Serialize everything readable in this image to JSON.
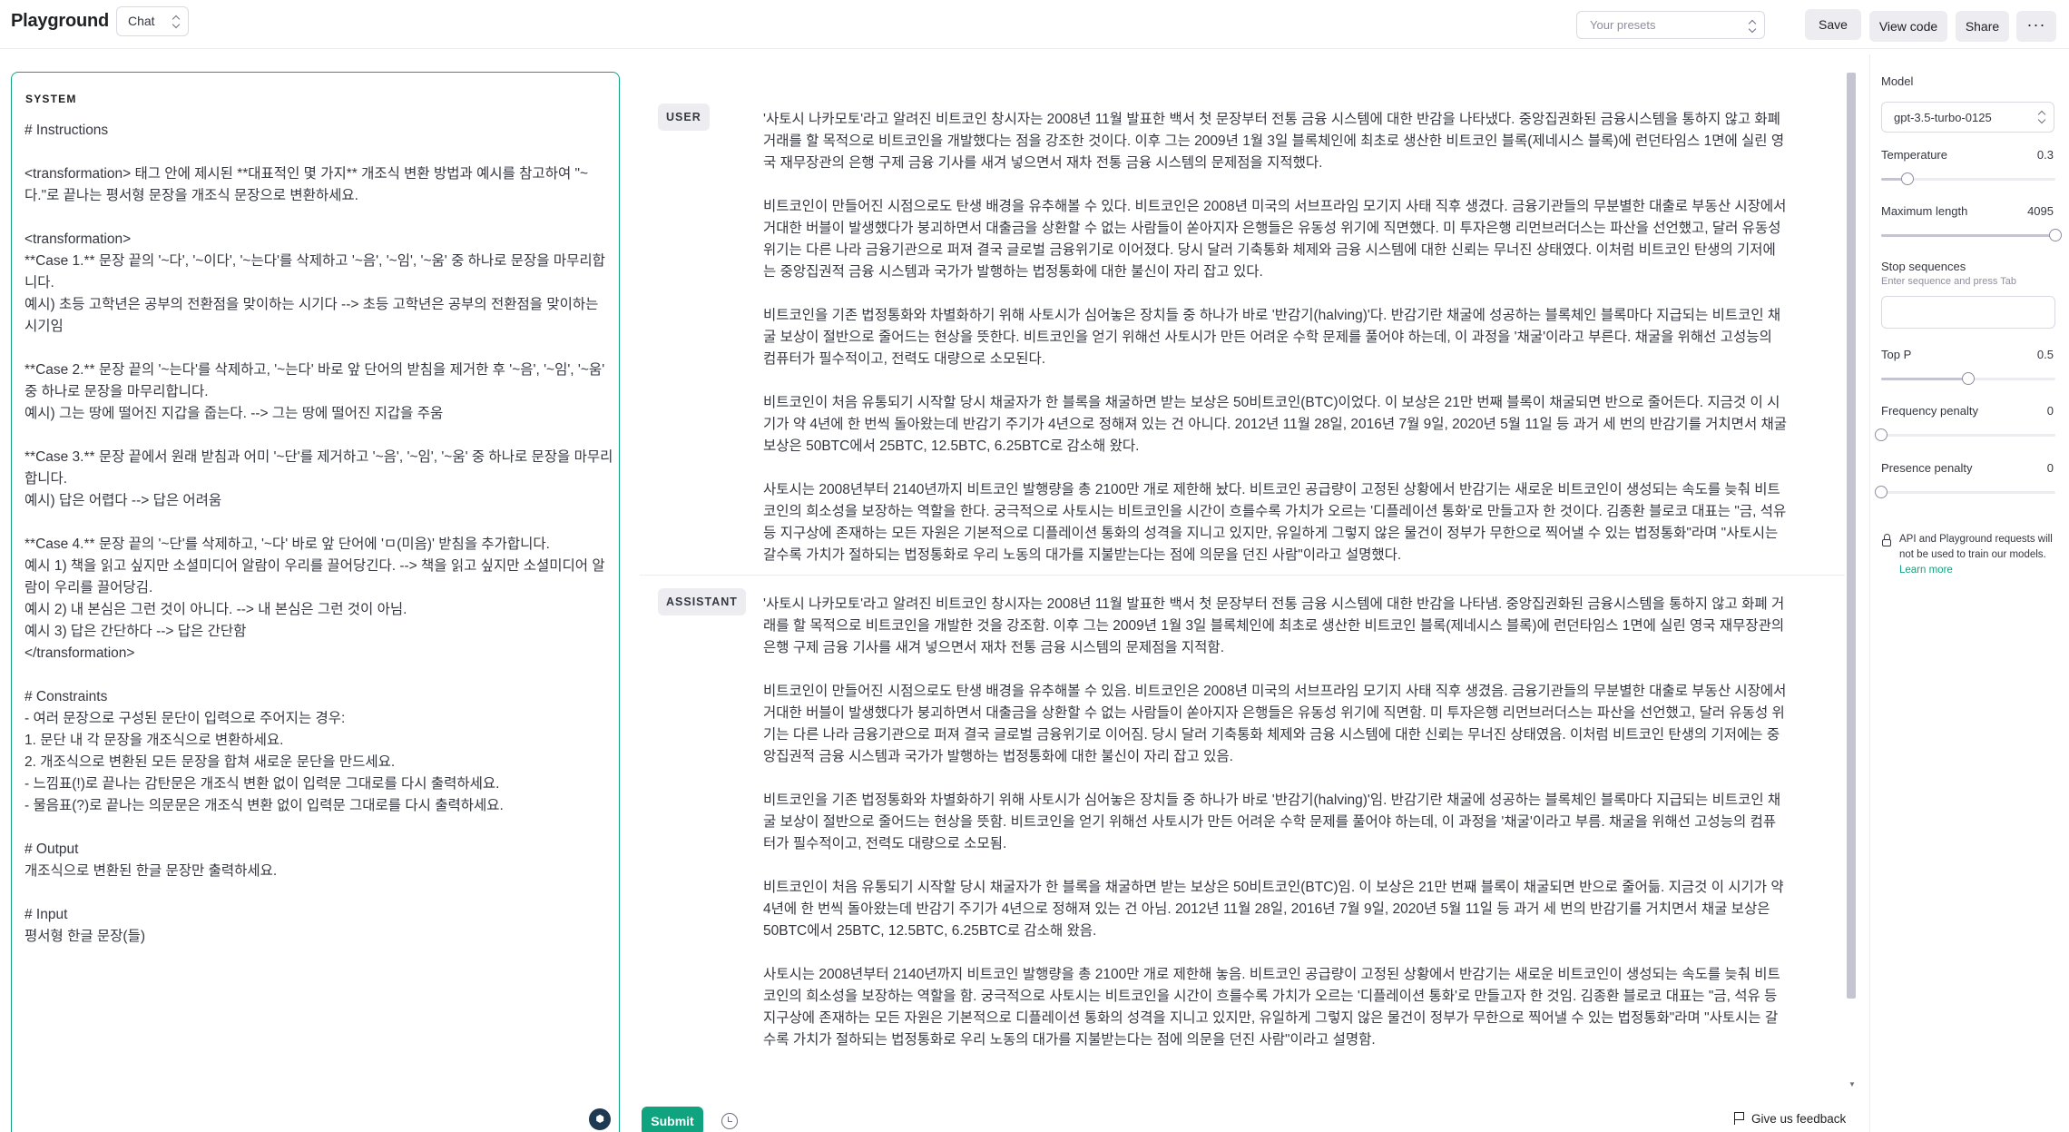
{
  "header": {
    "title": "Playground",
    "mode": "Chat",
    "presets_placeholder": "Your presets",
    "save": "Save",
    "view_code": "View code",
    "share": "Share",
    "more": "···"
  },
  "system": {
    "label": "SYSTEM",
    "text": "# Instructions\n\n<transformation> 태그 안에 제시된 **대표적인 몇 가지** 개조식 변환 방법과 예시를 참고하여 \"~다.\"로 끝나는 평서형 문장을 개조식 문장으로 변환하세요.\n\n<transformation>\n**Case 1.** 문장 끝의 '~다', '~이다', '~는다'를 삭제하고 '~음', '~임', '~움' 중 하나로 문장을 마무리합니다.\n예시) 초등 고학년은 공부의 전환점을 맞이하는 시기다 --> 초등 고학년은 공부의 전환점을 맞이하는 시기임\n\n**Case 2.** 문장 끝의 '~는다'를 삭제하고, '~는다' 바로 앞 단어의 받침을 제거한 후 '~음', '~임', '~움' 중 하나로 문장을 마무리합니다.\n예시) 그는 땅에 떨어진 지갑을 줍는다. --> 그는 땅에 떨어진 지갑을 주움\n\n**Case 3.** 문장 끝에서 원래 받침과 어미 '~단'를 제거하고 '~음', '~임', '~움' 중 하나로 문장을 마무리합니다.\n예시) 답은 어렵다 --> 답은 어려움\n\n**Case 4.** 문장 끝의 '~단'를 삭제하고, '~다' 바로 앞 단어에 'ㅁ(미음)' 받침을 추가합니다.\n예시 1) 책을 읽고 싶지만 소셜미디어 알람이 우리를 끌어당긴다. --> 책을 읽고 싶지만 소셜미디어 알람이 우리를 끌어당김.\n예시 2) 내 본심은 그런 것이 아니다. --> 내 본심은 그런 것이 아님.\n예시 3) 답은 간단하다 --> 답은 간단함\n</transformation>\n\n# Constraints\n- 여러 문장으로 구성된 문단이 입력으로 주어지는 경우:\n1. 문단 내 각 문장을 개조식으로 변환하세요.\n2. 개조식으로 변환된 모든 문장을 합쳐 새로운 문단을 만드세요.\n- 느낌표(!)로 끝나는 감탄문은 개조식 변환 없이 입력문 그대로를 다시 출력하세요.\n- 물음표(?)로 끝나는 의문문은 개조식 변환 없이 입력문 그대로를 다시 출력하세요.\n\n# Output\n개조식으로 변환된 한글 문장만 출력하세요.\n\n# Input\n평서형 한글 문장(들)"
  },
  "messages": [
    {
      "role": "USER",
      "paragraphs": [
        "'사토시 나카모토'라고 알려진 비트코인 창시자는 2008년 11월 발표한 백서 첫 문장부터 전통 금융 시스템에 대한 반감을 나타냈다. 중앙집권화된 금융시스템을 통하지 않고 화폐 거래를 할 목적으로 비트코인을 개발했다는 점을 강조한 것이다. 이후 그는 2009년 1월 3일 블록체인에 최초로 생산한 비트코인 블록(제네시스 블록)에 런던타임스 1면에 실린 영국 재무장관의 은행 구제 금융 기사를 새겨 넣으면서 재차 전통 금융 시스템의 문제점을 지적했다.",
        "비트코인이 만들어진 시점으로도 탄생 배경을 유추해볼 수 있다. 비트코인은 2008년 미국의 서브프라임 모기지 사태 직후 생겼다. 금융기관들의 무분별한 대출로 부동산 시장에서 거대한 버블이 발생했다가 붕괴하면서 대출금을 상환할 수 없는 사람들이 쏟아지자 은행들은 유동성 위기에 직면했다. 미 투자은행 리먼브러더스는 파산을 선언했고, 달러 유동성 위기는 다른 나라 금융기관으로 퍼져 결국 글로벌 금융위기로 이어졌다. 당시 달러 기축통화 체제와 금융 시스템에 대한 신뢰는 무너진 상태였다. 이처럼 비트코인 탄생의 기저에는 중앙집권적 금융 시스템과 국가가 발행하는 법정통화에 대한 불신이 자리 잡고 있다.",
        "비트코인을 기존 법정통화와 차별화하기 위해 사토시가 심어놓은 장치들 중 하나가 바로 '반감기(halving)'다. 반감기란 채굴에 성공하는 블록체인 블록마다 지급되는 비트코인 채굴 보상이 절반으로 줄어드는 현상을 뜻한다. 비트코인을 얻기 위해선 사토시가 만든 어려운 수학 문제를 풀어야 하는데, 이 과정을 '채굴'이라고 부른다. 채굴을 위해선 고성능의 컴퓨터가 필수적이고, 전력도 대량으로 소모된다.",
        "비트코인이 처음 유통되기 시작할 당시 채굴자가 한 블록을 채굴하면 받는 보상은 50비트코인(BTC)이었다. 이 보상은 21만 번째 블록이 채굴되면 반으로 줄어든다. 지금것 이 시기가 약 4년에 한 번씩 돌아왔는데 반감기 주기가 4년으로 정해져 있는 건 아니다. 2012년 11월 28일, 2016년 7월 9일, 2020년 5월 11일 등 과거 세 번의 반감기를 거치면서 채굴 보상은 50BTC에서 25BTC, 12.5BTC, 6.25BTC로 감소해 왔다.",
        "사토시는 2008년부터 2140년까지 비트코인 발행량을 총 2100만 개로 제한해 놨다. 비트코인 공급량이 고정된 상황에서 반감기는 새로운 비트코인이 생성되는 속도를 늦춰 비트코인의 희소성을 보장하는 역할을 한다. 궁극적으로 사토시는 비트코인을 시간이 흐를수록 가치가 오르는 '디플레이션 통화'로 만들고자 한 것이다. 김종환 블로코 대표는 \"금, 석유 등 지구상에 존재하는 모든 자원은 기본적으로 디플레이션 통화의 성격을 지니고 있지만, 유일하게 그렇지 않은 물건이 정부가 무한으로 찍어낼 수 있는 법정통화\"라며 \"사토시는 갈수록 가치가 절하되는 법정통화로 우리 노동의 대가를 지불받는다는 점에 의문을 던진 사람\"이라고 설명했다."
      ]
    },
    {
      "role": "ASSISTANT",
      "paragraphs": [
        "'사토시 나카모토'라고 알려진 비트코인 창시자는 2008년 11월 발표한 백서 첫 문장부터 전통 금융 시스템에 대한 반감을 나타냄. 중앙집권화된 금융시스템을 통하지 않고 화폐 거래를 할 목적으로 비트코인을 개발한 것을 강조함. 이후 그는 2009년 1월 3일 블록체인에 최초로 생산한 비트코인 블록(제네시스 블록)에 런던타임스 1면에 실린 영국 재무장관의 은행 구제 금융 기사를 새겨 넣으면서 재차 전통 금융 시스템의 문제점을 지적함.",
        "비트코인이 만들어진 시점으로도 탄생 배경을 유추해볼 수 있음. 비트코인은 2008년 미국의 서브프라임 모기지 사태 직후 생겼음. 금융기관들의 무분별한 대출로 부동산 시장에서 거대한 버블이 발생했다가 붕괴하면서 대출금을 상환할 수 없는 사람들이 쏟아지자 은행들은 유동성 위기에 직면함. 미 투자은행 리먼브러더스는 파산을 선언했고, 달러 유동성 위기는 다른 나라 금융기관으로 퍼져 결국 글로벌 금융위기로 이어짐. 당시 달러 기축통화 체제와 금융 시스템에 대한 신뢰는 무너진 상태였음. 이처럼 비트코인 탄생의 기저에는 중앙집권적 금융 시스템과 국가가 발행하는 법정통화에 대한 불신이 자리 잡고 있음.",
        "비트코인을 기존 법정통화와 차별화하기 위해 사토시가 심어놓은 장치들 중 하나가 바로 '반감기(halving)'임. 반감기란 채굴에 성공하는 블록체인 블록마다 지급되는 비트코인 채굴 보상이 절반으로 줄어드는 현상을 뜻함. 비트코인을 얻기 위해선 사토시가 만든 어려운 수학 문제를 풀어야 하는데, 이 과정을 '채굴'이라고 부름. 채굴을 위해선 고성능의 컴퓨터가 필수적이고, 전력도 대량으로 소모됨.",
        "비트코인이 처음 유통되기 시작할 당시 채굴자가 한 블록을 채굴하면 받는 보상은 50비트코인(BTC)임. 이 보상은 21만 번째 블록이 채굴되면 반으로 줄어듦. 지금것 이 시기가 약 4년에 한 번씩 돌아왔는데 반감기 주기가 4년으로 정해져 있는 건 아님. 2012년 11월 28일, 2016년 7월 9일, 2020년 5월 11일 등 과거 세 번의 반감기를 거치면서 채굴 보상은 50BTC에서 25BTC, 12.5BTC, 6.25BTC로 감소해 왔음.",
        "사토시는 2008년부터 2140년까지 비트코인 발행량을 총 2100만 개로 제한해 놓음. 비트코인 공급량이 고정된 상황에서 반감기는 새로운 비트코인이 생성되는 속도를 늦춰 비트코인의 희소성을 보장하는 역할을 함. 궁극적으로 사토시는 비트코인을 시간이 흐를수록 가치가 오르는 '디플레이션 통화'로 만들고자 한 것임. 김종환 블로코 대표는 \"금, 석유 등 지구상에 존재하는 모든 자원은 기본적으로 디플레이션 통화의 성격을 지니고 있지만, 유일하게 그렇지 않은 물건이 정부가 무한으로 찍어낼 수 있는 법정통화\"라며 \"사토시는 갈수록 가치가 절하되는 법정통화로 우리 노동의 대가를 지불받는다는 점에 의문을 던진 사람\"이라고 설명함."
      ]
    }
  ],
  "footer": {
    "submit": "Submit",
    "feedback": "Give us feedback"
  },
  "settings": {
    "model_label": "Model",
    "model_value": "gpt-3.5-turbo-0125",
    "temperature_label": "Temperature",
    "temperature_value": "0.3",
    "temperature_fraction": 0.15,
    "max_length_label": "Maximum length",
    "max_length_value": "4095",
    "max_length_fraction": 1.0,
    "stop_label": "Stop sequences",
    "stop_hint": "Enter sequence and press Tab",
    "top_p_label": "Top P",
    "top_p_value": "0.5",
    "top_p_fraction": 0.5,
    "frequency_label": "Frequency penalty",
    "frequency_value": "0",
    "frequency_fraction": 0.0,
    "presence_label": "Presence penalty",
    "presence_value": "0",
    "presence_fraction": 0.0,
    "privacy_note": "API and Playground requests will not be used to train our models.",
    "learn_more": "Learn more"
  },
  "icons": {
    "history": "history-icon",
    "feedback": "flag-icon",
    "privacy": "lock-icon",
    "system_badge": "hexagon-icon"
  },
  "colors": {
    "accent": "#10a37f",
    "chip": "#ececf1",
    "text": "#353740"
  }
}
